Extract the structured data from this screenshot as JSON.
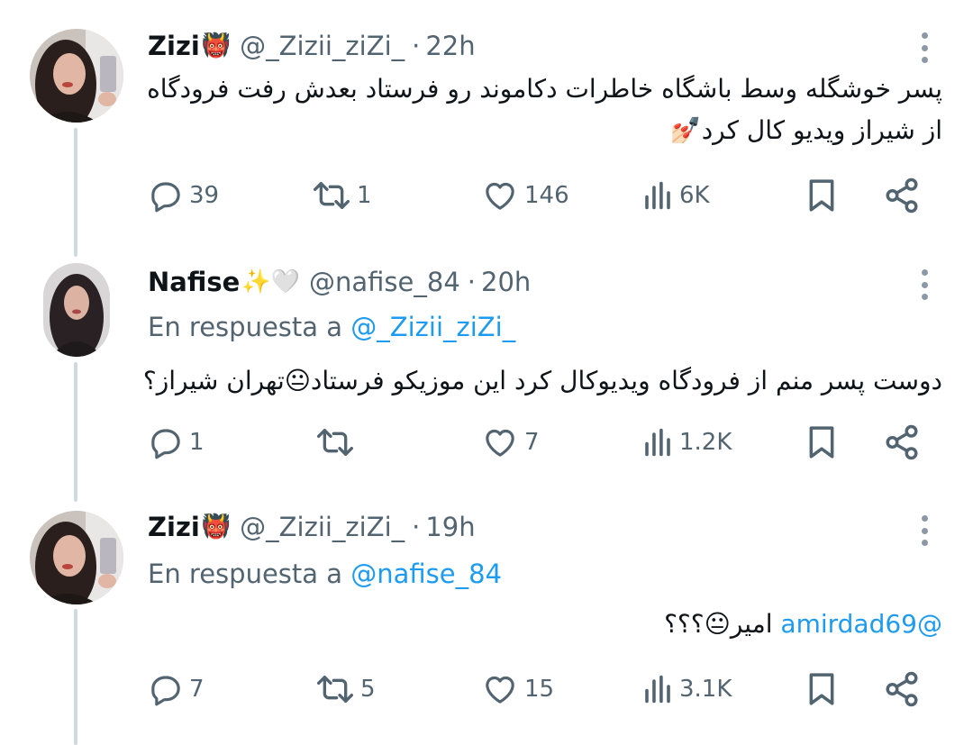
{
  "tweets": [
    {
      "display_name": "Zizi",
      "name_emoji": "👹",
      "handle": "@_Zizii_ziZi_",
      "separator": "·",
      "time": "22h",
      "reply_label": "",
      "reply_mention": "",
      "text_line1": "پسر خوشگله وسط باشگاه خاطرات دکاموند رو فرستاد بعدش رفت فرودگاه",
      "text_line2": "از شیراز ویدیو کال کرد💅🏻",
      "stats": {
        "replies": "39",
        "retweets": "1",
        "likes": "146",
        "views": "6K"
      }
    },
    {
      "display_name": "Nafise",
      "name_emoji": "✨🤍",
      "handle": "@nafise_84",
      "separator": "·",
      "time": "20h",
      "reply_label": "En respuesta a",
      "reply_mention": "@_Zizii_ziZi_",
      "text_line1": "دوست پسر منم از فرودگاه ویدیوکال کرد این موزیکو فرستاد😐تهران شیراز؟",
      "stats": {
        "replies": "1",
        "retweets": "",
        "likes": "7",
        "views": "1.2K"
      }
    },
    {
      "display_name": "Zizi",
      "name_emoji": "👹",
      "handle": "@_Zizii_ziZi_",
      "separator": "·",
      "time": "19h",
      "reply_label": "En respuesta a",
      "reply_mention": "@nafise_84",
      "text_mention": "@amirdad69",
      "text_rest": "امیر😐؟؟؟",
      "stats": {
        "replies": "7",
        "retweets": "5",
        "likes": "15",
        "views": "3.1K"
      }
    }
  ],
  "icons": [
    "reply-icon",
    "retweet-icon",
    "like-icon",
    "views-icon",
    "bookmark-icon",
    "share-icon",
    "more-icon"
  ],
  "colors": {
    "text": "#0f1419",
    "secondary": "#536471",
    "link": "#1d9bf0",
    "thread_line": "#cfd9de"
  }
}
